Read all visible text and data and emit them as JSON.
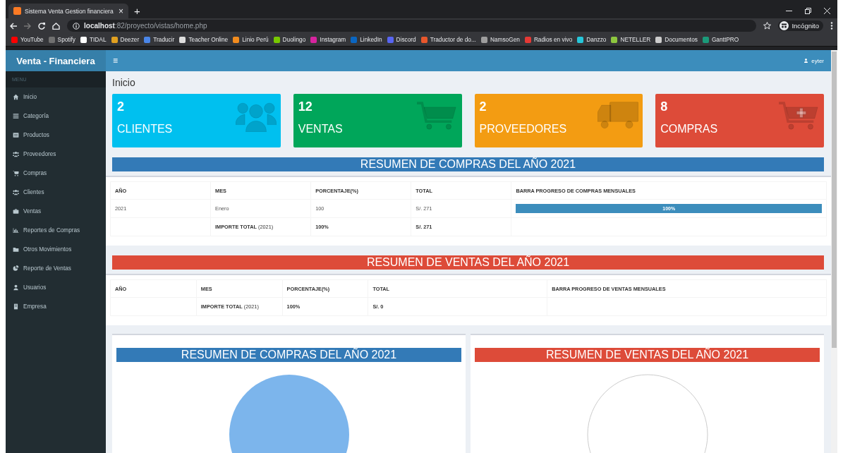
{
  "browser": {
    "tab_title": "Sistema Venta Gestion financiera",
    "tab_close": "×",
    "new_tab": "+",
    "url_host": "localhost",
    "url_path": ":82/proyecto/vistas/home.php",
    "profile": "Incógnito",
    "bookmarks": [
      {
        "label": "YouTube",
        "color": "#ff0000"
      },
      {
        "label": "Spotify",
        "color": "#707070"
      },
      {
        "label": "TIDAL",
        "color": "#ffffff"
      },
      {
        "label": "Deezer",
        "color": "#e0a020"
      },
      {
        "label": "Traducir",
        "color": "#4a86e8"
      },
      {
        "label": "Teacher Online",
        "color": "#dddddd"
      },
      {
        "label": "Linio Perú",
        "color": "#f28c1e"
      },
      {
        "label": "Duolingo",
        "color": "#78c800"
      },
      {
        "label": "Instagram",
        "color": "#d6249f"
      },
      {
        "label": "LinkedIn",
        "color": "#0a66c2"
      },
      {
        "label": "Discord",
        "color": "#5865f2"
      },
      {
        "label": "Traductor de do...",
        "color": "#e8572c"
      },
      {
        "label": "NamsoGen",
        "color": "#9e9e9e"
      },
      {
        "label": "Radios en vivo",
        "color": "#e53935"
      },
      {
        "label": "Danzzo",
        "color": "#26c6da"
      },
      {
        "label": "NETELLER",
        "color": "#8dc63f"
      },
      {
        "label": "Documentos",
        "color": "#cccccc"
      },
      {
        "label": "GanttPRO",
        "color": "#1b9a7a"
      }
    ]
  },
  "app": {
    "brand": "Venta - Financiera",
    "menu_toggle": "≡",
    "user": "eyter"
  },
  "sidebar": {
    "header": "MENU",
    "items": [
      {
        "label": "Inicio",
        "kind": "home"
      },
      {
        "label": "Categoría",
        "kind": "list"
      },
      {
        "label": "Productos",
        "kind": "table"
      },
      {
        "label": "Proveedores",
        "kind": "users"
      },
      {
        "label": "Compras",
        "kind": "cart"
      },
      {
        "label": "Clientes",
        "kind": "users"
      },
      {
        "label": "Ventas",
        "kind": "briefcase"
      },
      {
        "label": "Reportes de Compras",
        "kind": "chart"
      },
      {
        "label": "Otros Movimientos",
        "kind": "folder"
      },
      {
        "label": "Reporte de Ventas",
        "kind": "pie"
      },
      {
        "label": "Usuarios",
        "kind": "user"
      },
      {
        "label": "Empresa",
        "kind": "building"
      }
    ]
  },
  "page_title": "Inicio",
  "stats": [
    {
      "value": "2",
      "label": "CLIENTES",
      "color": "#00c0ef",
      "kind": "users"
    },
    {
      "value": "12",
      "label": "VENTAS",
      "color": "#00a65a",
      "kind": "cart"
    },
    {
      "value": "2",
      "label": "PROVEEDORES",
      "color": "#f39c12",
      "kind": "truck"
    },
    {
      "value": "8",
      "label": "COMPRAS",
      "color": "#dd4b39",
      "kind": "cart-plus"
    }
  ],
  "summaries": [
    {
      "kind": "purchases",
      "title": "RESUMEN DE COMPRAS DEL AÑO 2021",
      "columns": [
        "AÑO",
        "MES",
        "PORCENTAJE(%)",
        "TOTAL",
        "BARRA PROGRESO DE COMPRAS MENSUALES"
      ],
      "rows": [
        {
          "cells": [
            "2021",
            "Enero",
            "100",
            "S/. 271"
          ],
          "level": 1,
          "reading": "100%"
        }
      ],
      "total": {
        "label": "**IMPORTE TOTAL** (2021)",
        "percent": "100%",
        "amount": "S/. 271"
      }
    },
    {
      "kind": "sales",
      "title": "RESUMEN DE VENTAS DEL AÑO 2021",
      "columns": [
        "AÑO",
        "MES",
        "PORCENTAJE(%)",
        "TOTAL",
        "BARRA PROGRESO DE VENTAS MENSUALES"
      ],
      "total": {
        "label": "**IMPORTE TOTAL** (2021)",
        "percent": "100%",
        "amount": "S/. 0"
      }
    }
  ],
  "charts": [
    {
      "kind": "purchases",
      "title": "RESUMEN DE COMPRAS DEL AÑO 2021",
      "filled": true
    },
    {
      "kind": "sales",
      "title": "RESUMEN DE VENTAS DEL AÑO 2021",
      "filled": false
    }
  ]
}
